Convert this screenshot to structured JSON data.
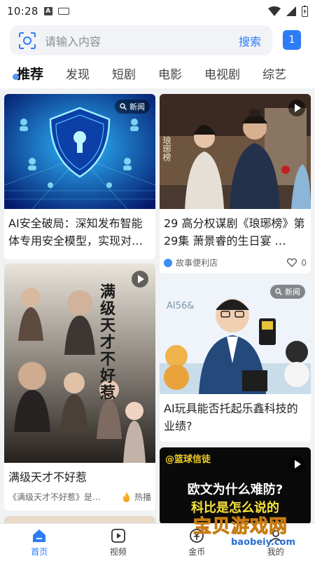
{
  "status": {
    "time": "10:28",
    "a_icon_letter": "A"
  },
  "search": {
    "placeholder": "请输入内容",
    "button": "搜索",
    "badge": "1"
  },
  "tabs": [
    "推荐",
    "发现",
    "短剧",
    "电影",
    "电视剧",
    "综艺"
  ],
  "cards": [
    {
      "title": "AI安全破局：深知发布智能体专用安全模型，实现对…",
      "tag": "新闻"
    },
    {
      "title": "29 高分权谋剧《琅琊榜》第29集 萧景睿的生日宴 …",
      "source": "故事便利店",
      "likes": "0",
      "thumb_text": "琅琊榜"
    },
    {
      "title": "满级天才不好惹",
      "poster_title": "满级天才不好惹",
      "sub": "《满级天才不好惹》是…",
      "hot_label": "热播"
    },
    {
      "title": "AI玩具能否托起乐鑫科技的业绩?",
      "tag": "新闻",
      "thumb_text": "AI56&"
    },
    {
      "thumb_title_line1": "欧文为什么难防?",
      "thumb_title_line2": "科比是怎么说的",
      "channel": "@篮球信徒"
    }
  ],
  "nav": [
    {
      "label": "首页",
      "active": true
    },
    {
      "label": "视频",
      "active": false
    },
    {
      "label": "金币",
      "active": false
    },
    {
      "label": "我的",
      "active": false
    }
  ],
  "watermark": {
    "text": "宝贝游戏网",
    "url": "baobeiy.com"
  },
  "colors": {
    "accent": "#2d7cf6",
    "feed_bg": "#f1f2f4"
  }
}
